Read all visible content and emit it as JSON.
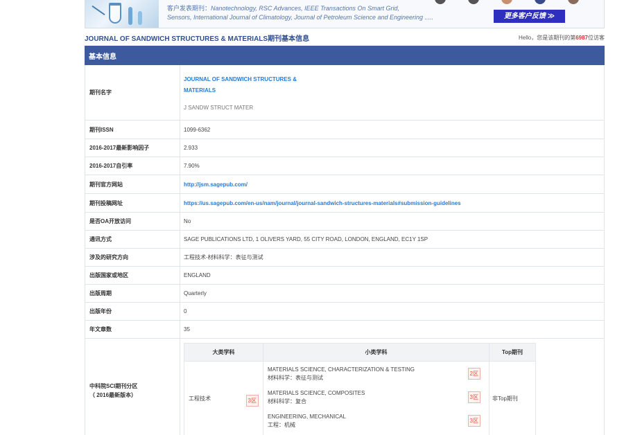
{
  "banner": {
    "lead": "客户发表期刊：",
    "line1": "Nanotechnology,  RSC Advances,  IEEE Transactions On Smart Grid,",
    "line2": "Sensors,  International Journal of Climatology,  Journal of Petroleum Science and Engineering .....",
    "feedback_button": "更多客户反馈 ≫"
  },
  "header": {
    "title": "JOURNAL OF SANDWICH STRUCTURES & MATERIALS期刊基本信息",
    "visitor_prefix": "Hello，您是该期刊的第",
    "visitor_count": "6987",
    "visitor_suffix": "位访客"
  },
  "table": {
    "header": "基本信息",
    "rows": {
      "name_label": "期刊名字",
      "name_line1": "JOURNAL OF SANDWICH STRUCTURES &",
      "name_line2": "MATERIALS",
      "name_abbr": "J SANDW STRUCT MATER",
      "issn_label": "期刊ISSN",
      "issn": "1099-6362",
      "if_label": "2016-2017最新影响因子",
      "if": "2.933",
      "selfcite_label": "2016-2017自引率",
      "selfcite": "7.90%",
      "website_label": "期刊官方网站",
      "website": "http://jsm.sagepub.com/",
      "submit_label": "期刊投稿网址",
      "submit": "https://us.sagepub.com/en-us/nam/journal/journal-sandwich-structures-materials#submission-guidelines",
      "oa_label": "是否OA开放访问",
      "oa": "No",
      "contact_label": "通讯方式",
      "contact": "SAGE PUBLICATIONS LTD, 1 OLIVERS YARD, 55 CITY ROAD, LONDON, ENGLAND, EC1Y 1SP",
      "field_label": "涉及的研究方向",
      "field": "工程技术-材料科学：表征与测试",
      "country_label": "出版国家或地区",
      "country": "ENGLAND",
      "freq_label": "出版周期",
      "freq": "Quarterly",
      "year_label": "出版年份",
      "year": "0",
      "articles_label": "年文章数",
      "articles": "35",
      "cas_label_line1": "中科院SCI期刊分区",
      "cas_label_line2": "（ 2016最新版本）"
    },
    "cas": {
      "col_major": "大类学科",
      "col_minor": "小类学科",
      "col_top": "Top期刊",
      "major": "工程技术",
      "major_zone": "3区",
      "top": "非Top期刊",
      "minors": [
        {
          "en": "MATERIALS SCIENCE, CHARACTERIZATION & TESTING",
          "cn": "材料科学：表征与测试",
          "zone": "2区"
        },
        {
          "en": "MATERIALS SCIENCE, COMPOSITES",
          "cn": "材料科学：复合",
          "zone": "3区"
        },
        {
          "en": "ENGINEERING, MECHANICAL",
          "cn": "工程：机械",
          "zone": "3区"
        }
      ]
    }
  }
}
